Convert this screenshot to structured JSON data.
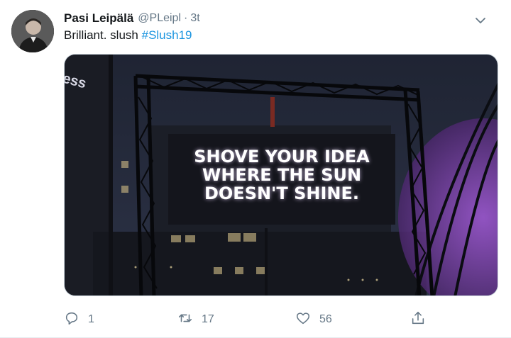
{
  "tweet": {
    "author_name": "Pasi Leipälä",
    "handle": "@PLeipl",
    "separator": "·",
    "time": "3t",
    "text_plain": "Brilliant. slush ",
    "hashtag": "#Slush19",
    "media": {
      "billboard_line1": "SHOVE YOUR IDEA",
      "billboard_line2": "WHERE THE SUN",
      "billboard_line3": "DOESN'T SHINE.",
      "corner_text": "ess"
    },
    "actions": {
      "reply_count": "1",
      "retweet_count": "17",
      "like_count": "56"
    }
  },
  "colors": {
    "link": "#1b95e0",
    "muted": "#657786",
    "text": "#14171a"
  },
  "icons": {
    "reply": "reply-icon",
    "retweet": "retweet-icon",
    "like": "heart-icon",
    "share": "share-icon",
    "more": "chevron-down-icon"
  }
}
